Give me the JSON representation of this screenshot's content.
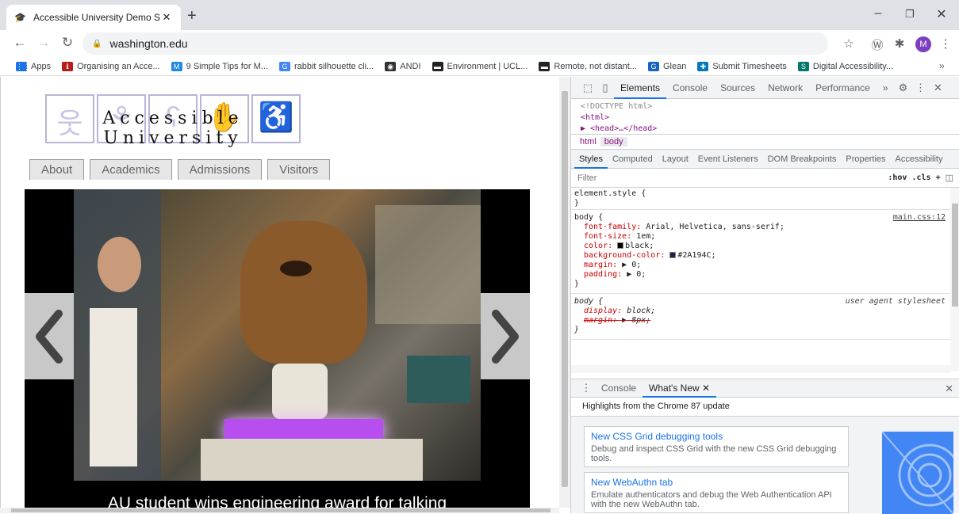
{
  "browser": {
    "tab_title": "Accessible University Demo Site",
    "tab_favicon": "mortarboard-icon",
    "new_tab": "+",
    "url": "washington.edu",
    "window_controls": {
      "minimize": "–",
      "restore": "❐",
      "close": "✕"
    },
    "avatar_letter": "M"
  },
  "bookmarks": [
    {
      "label": "Apps",
      "icon": "apps-grid-icon",
      "color": "#1a73e8"
    },
    {
      "label": "Organising an Acce...",
      "icon": "sassy-logo-icon",
      "color": "#b71c1c"
    },
    {
      "label": "9 Simple Tips for M...",
      "icon": "m-badge-icon",
      "color": "#1e88e5"
    },
    {
      "label": "rabbit silhouette cli...",
      "icon": "google-icon",
      "color": "#4285f4"
    },
    {
      "label": "ANDI",
      "icon": "andi-icon",
      "color": "#333333"
    },
    {
      "label": "Environment | UCL...",
      "icon": "ucl-icon",
      "color": "#222222"
    },
    {
      "label": "Remote, not distant...",
      "icon": "ucl-icon",
      "color": "#222222"
    },
    {
      "label": "Glean",
      "icon": "glean-icon",
      "color": "#1565c0"
    },
    {
      "label": "Submit Timesheets",
      "icon": "cross-icon",
      "color": "#0277bd"
    },
    {
      "label": "Digital Accessibility...",
      "icon": "sharepoint-icon",
      "color": "#00796b"
    }
  ],
  "bookmarks_more": "»",
  "site": {
    "logo_text": "Accessible University",
    "nav": [
      "About",
      "Academics",
      "Admissions",
      "Visitors"
    ],
    "carousel_caption": "AU student wins engineering award for talking",
    "prev_label": "‹",
    "next_label": "›"
  },
  "devtools": {
    "top_tabs": [
      "Elements",
      "Console",
      "Sources",
      "Network",
      "Performance"
    ],
    "more": "»",
    "dom": [
      "<!DOCTYPE html>",
      "<html>",
      "▶ <head>…</head>"
    ],
    "crumbs": [
      "html",
      "body"
    ],
    "sub_tabs": [
      "Styles",
      "Computed",
      "Layout",
      "Event Listeners",
      "DOM Breakpoints",
      "Properties",
      "Accessibility"
    ],
    "filter_placeholder": "Filter",
    "filter_tools": ":hov  .cls  +",
    "rules": {
      "element_style": "element.style {",
      "close": "}",
      "body_selector": "body {",
      "body_source": "main.css:12",
      "body_props": [
        {
          "name": "font-family",
          "value": "Arial, Helvetica, sans-serif;"
        },
        {
          "name": "font-size",
          "value": "1em;"
        },
        {
          "name": "color",
          "value": "black;",
          "swatch": "#000000"
        },
        {
          "name": "background-color",
          "value": "#2A194C;",
          "swatch": "#2A194C"
        },
        {
          "name": "margin",
          "value": "▶ 0;"
        },
        {
          "name": "padding",
          "value": "▶ 0;"
        }
      ],
      "ua_selector": "body {",
      "ua_source": "user agent stylesheet",
      "ua_props": [
        {
          "name": "display",
          "value": "block;"
        },
        {
          "name": "margin",
          "value": "▶ 8px;"
        }
      ]
    },
    "drawer_tabs": [
      "Console",
      "What's New ✕"
    ],
    "drawer_close": "✕",
    "highlights": "Highlights from the Chrome 87 update",
    "whats_new": [
      {
        "title": "New CSS Grid debugging tools",
        "desc": "Debug and inspect CSS Grid with the new CSS Grid debugging tools."
      },
      {
        "title": "New WebAuthn tab",
        "desc": "Emulate authenticators and debug the Web Authentication API with the new WebAuthn tab."
      }
    ]
  }
}
